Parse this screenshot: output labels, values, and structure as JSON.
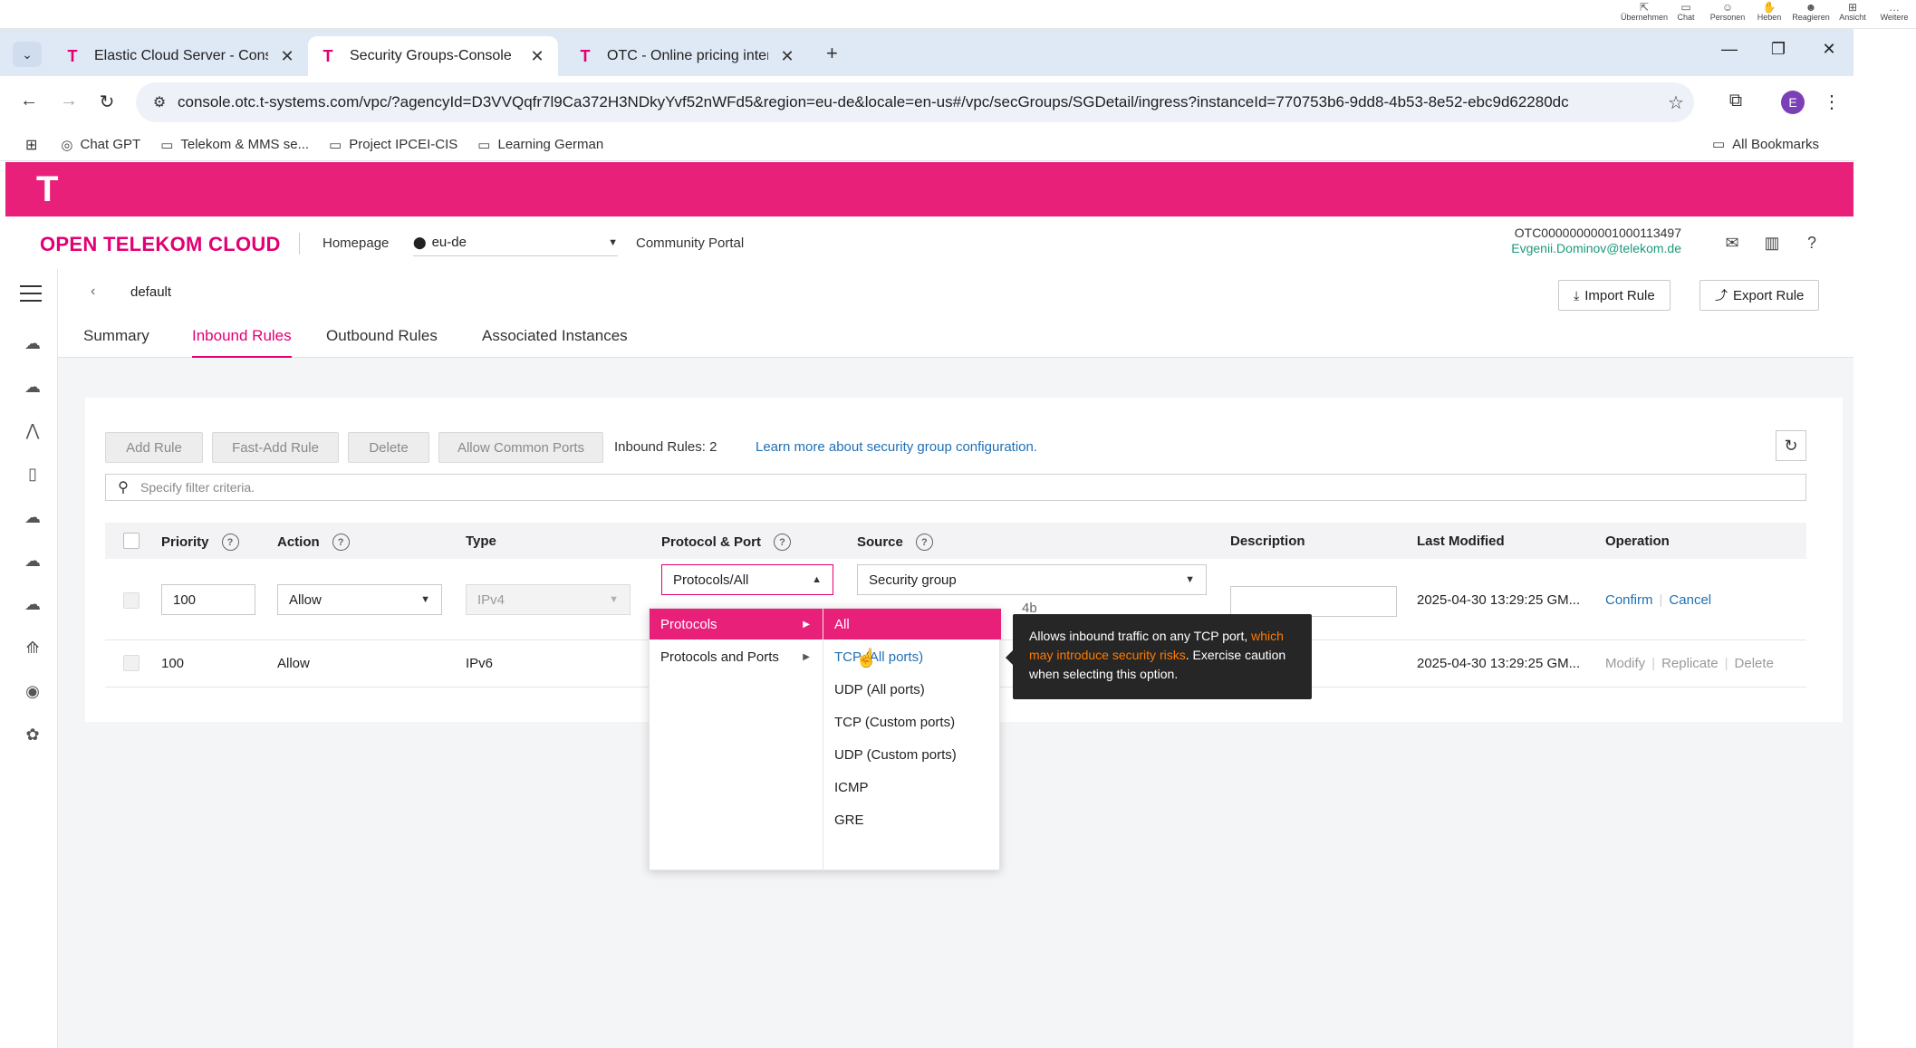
{
  "os_toolbar": {
    "items": [
      {
        "icon": "share-screen-icon",
        "label": "Übernehmen"
      },
      {
        "icon": "chat-icon",
        "label": "Chat"
      },
      {
        "icon": "people-icon",
        "label": "Personen"
      },
      {
        "icon": "raise-hand-icon",
        "label": "Heben"
      },
      {
        "icon": "react-icon",
        "label": "Reagieren"
      },
      {
        "icon": "view-icon",
        "label": "Ansicht"
      },
      {
        "icon": "more-icon",
        "label": "Weitere"
      }
    ]
  },
  "browser": {
    "tabs": [
      {
        "label": "Elastic Cloud Server - Console",
        "close": "✕"
      },
      {
        "label": "Security Groups-Console",
        "close": "✕"
      },
      {
        "label": "OTC - Online pricing interface",
        "close": "✕"
      }
    ],
    "new_tab": "+",
    "url": "console.otc.t-systems.com/vpc/?agencyId=D3VVQqfr7l9Ca372H3NDkyYvf52nWFd5&region=eu-de&locale=en-us#/vpc/secGroups/SGDetail/ingress?instanceId=770753b6-9dd8-4b53-8e52-ebc9d62280dc",
    "profile_initial": "E",
    "bookmarks": [
      {
        "label": "Chat GPT"
      },
      {
        "label": "Telekom & MMS se..."
      },
      {
        "label": "Project IPCEI-CIS"
      },
      {
        "label": "Learning German"
      }
    ],
    "all_bookmarks": "All Bookmarks"
  },
  "header": {
    "logo": "T",
    "brand": "OPEN TELEKOM CLOUD",
    "homepage": "Homepage",
    "region": "eu-de",
    "community": "Community Portal",
    "account_id": "OTC00000000001000113497",
    "account_email": "Evgenii.Dominov@telekom.de",
    "help": "?"
  },
  "page": {
    "breadcrumb": "default",
    "import_rule": "Import Rule",
    "export_rule": "Export Rule",
    "tabs": [
      {
        "label": "Summary"
      },
      {
        "label": "Inbound Rules"
      },
      {
        "label": "Outbound Rules"
      },
      {
        "label": "Associated Instances"
      }
    ],
    "actions": {
      "add_rule": "Add Rule",
      "fast_add_rule": "Fast-Add Rule",
      "delete": "Delete",
      "allow_common_ports": "Allow Common Ports",
      "rules_count": "Inbound Rules: 2",
      "learn_more": "Learn more about security group configuration."
    },
    "filter_placeholder": "Specify filter criteria.",
    "table": {
      "headers": {
        "priority": "Priority",
        "action": "Action",
        "type": "Type",
        "protocol_port": "Protocol & Port",
        "source": "Source",
        "description": "Description",
        "last_modified": "Last Modified",
        "operation": "Operation"
      },
      "edit_row": {
        "priority": "100",
        "action": "Allow",
        "type": "IPv4",
        "protocol": "Protocols/All",
        "source": "Security group",
        "source_partial": "4b",
        "description": "",
        "last_modified": "2025-04-30 13:29:25 GM...",
        "confirm": "Confirm",
        "cancel": "Cancel"
      },
      "rows": [
        {
          "priority": "100",
          "action": "Allow",
          "type": "IPv6",
          "last_modified": "2025-04-30 13:29:25 GM...",
          "modify": "Modify",
          "replicate": "Replicate",
          "delete": "Delete"
        }
      ]
    },
    "dropdown": {
      "level1": [
        {
          "label": "Protocols",
          "selected": true
        },
        {
          "label": "Protocols and Ports",
          "selected": false
        }
      ],
      "level2": [
        {
          "label": "All",
          "selected": true
        },
        {
          "label": "TCP (All ports)",
          "hover": true
        },
        {
          "label": "UDP (All ports)"
        },
        {
          "label": "TCP (Custom ports)"
        },
        {
          "label": "UDP (Custom ports)"
        },
        {
          "label": "ICMP"
        },
        {
          "label": "GRE"
        }
      ]
    },
    "tooltip": {
      "text_before": "Allows inbound traffic on any TCP port, ",
      "warning": "which may introduce security risks",
      "text_after": ". Exercise caution when selecting this option."
    }
  },
  "colors": {
    "brand_magenta": "#e20074",
    "link_blue": "#1f6fb5",
    "account_green": "#1a9a7a",
    "tooltip_warning": "#ff7a00"
  }
}
